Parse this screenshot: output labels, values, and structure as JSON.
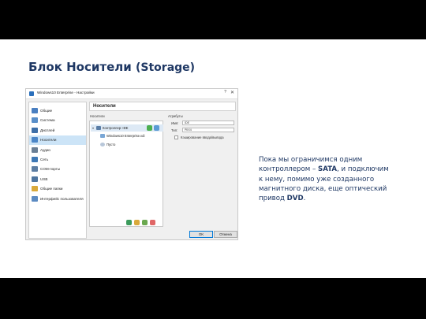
{
  "slide": {
    "title": "Блок Носители",
    "title_suffix": "(Storage)",
    "body_pre": "Пока мы ограничимся одним контроллером – ",
    "body_b1": "SATA",
    "body_mid": ", и подключим к нему, помимо уже созданного магнитного диска, еще оптический привод ",
    "body_b2": "DVD",
    "body_end": "."
  },
  "dialog": {
    "title": "Windows10 Enterprise - Настройки",
    "help": "?",
    "close": "✕",
    "nav": [
      {
        "label": "Общие",
        "icon": "general-icon",
        "color": "#4a7fc1"
      },
      {
        "label": "Система",
        "icon": "system-icon",
        "color": "#5a8fc9"
      },
      {
        "label": "Дисплей",
        "icon": "display-icon",
        "color": "#3d6fa8"
      },
      {
        "label": "Носители",
        "icon": "storage-icon",
        "color": "#4b86c7",
        "selected": true
      },
      {
        "label": "Аудио",
        "icon": "audio-icon",
        "color": "#6a7f95"
      },
      {
        "label": "Сеть",
        "icon": "network-icon",
        "color": "#3f79b5"
      },
      {
        "label": "COM-порты",
        "icon": "com-port-icon",
        "color": "#5d7ea3"
      },
      {
        "label": "USB",
        "icon": "usb-icon",
        "color": "#4f76a0"
      },
      {
        "label": "Общие папки",
        "icon": "shared-folder-icon",
        "color": "#d9a93b"
      },
      {
        "label": "Интерфейс пользователя",
        "icon": "user-interface-icon",
        "color": "#5c8bc2"
      }
    ],
    "panel_title": "Носители",
    "tree_label": "Носители",
    "tree": {
      "controller": "Контроллер: IDE",
      "disk": "Windows10 Enterprise.vdi",
      "empty": "Пусто"
    },
    "attr_label": "Атрибуты",
    "attrs": {
      "name_label": "Имя:",
      "name_value": "IDE",
      "type_label": "Тип:",
      "type_value": "PIIX4",
      "cache_label": "Кэширование ввода/вывода"
    },
    "ok": "OK",
    "cancel": "Отмена"
  }
}
